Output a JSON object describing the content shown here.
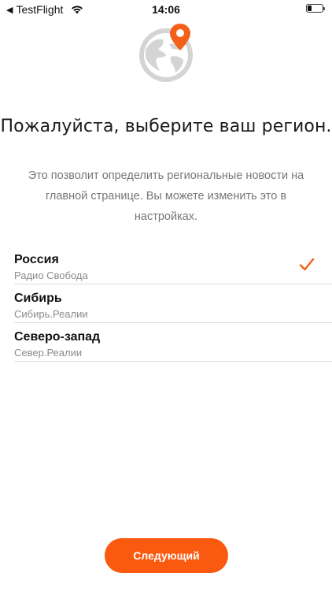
{
  "status_bar": {
    "back_app": "TestFlight",
    "time": "14:06",
    "battery_level": 0.3
  },
  "icons": {
    "globe": "globe-with-location-pin-icon",
    "checkmark": "checkmark-icon",
    "wifi": "wifi-icon",
    "battery": "battery-icon",
    "back": "back-chevron-icon"
  },
  "colors": {
    "accent": "#fa5a0f",
    "globe_gray": "#d4d4d4",
    "text_secondary": "#8a8a8a"
  },
  "onboarding": {
    "title": "Пожалуйста, выберите ваш регион.",
    "description": "Это позволит определить региональные новости на главной странице. Вы можете изменить это в настройках."
  },
  "regions": [
    {
      "name": "Россия",
      "subtitle": "Радио Свобода",
      "selected": true
    },
    {
      "name": "Сибирь",
      "subtitle": "Сибирь.Реалии",
      "selected": false
    },
    {
      "name": "Северо-запад",
      "subtitle": "Север.Реалии",
      "selected": false
    }
  ],
  "next_button": {
    "label": "Следующий"
  }
}
